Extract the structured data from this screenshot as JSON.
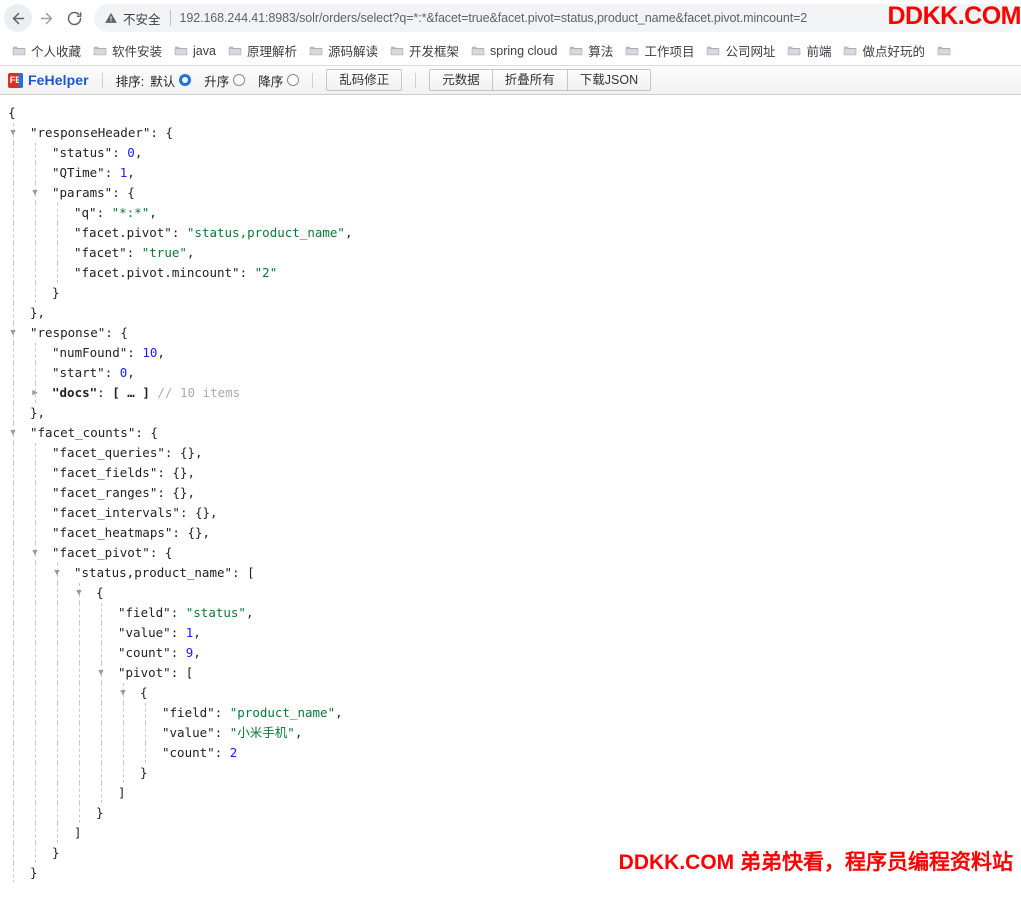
{
  "browser": {
    "back_icon": "arrow-left-icon",
    "forward_icon": "arrow-right-icon",
    "reload_icon": "reload-icon",
    "security_icon": "warning-triangle-icon",
    "security_label": "不安全",
    "url": "192.168.244.41:8983/solr/orders/select?q=*:*&facet=true&facet.pivot=status,product_name&facet.pivot.mincount=2"
  },
  "bookmarks": [
    {
      "label": "个人收藏",
      "icon": "folder-icon"
    },
    {
      "label": "软件安装",
      "icon": "folder-icon"
    },
    {
      "label": "java",
      "icon": "folder-icon"
    },
    {
      "label": "原理解析",
      "icon": "folder-icon"
    },
    {
      "label": "源码解读",
      "icon": "folder-icon"
    },
    {
      "label": "开发框架",
      "icon": "folder-icon"
    },
    {
      "label": "spring cloud",
      "icon": "folder-icon"
    },
    {
      "label": "算法",
      "icon": "folder-icon"
    },
    {
      "label": "工作项目",
      "icon": "folder-icon"
    },
    {
      "label": "公司网址",
      "icon": "folder-icon"
    },
    {
      "label": "前端",
      "icon": "folder-icon"
    },
    {
      "label": "做点好玩的",
      "icon": "folder-icon"
    },
    {
      "label": "",
      "icon": "folder-icon"
    }
  ],
  "fehelper": {
    "logo_text": "FE",
    "title": "FeHelper",
    "sort_label": "排序:",
    "sort_options": [
      {
        "label": "默认",
        "checked": true
      },
      {
        "label": "升序",
        "checked": false
      },
      {
        "label": "降序",
        "checked": false
      }
    ],
    "fix_encoding_button": "乱码修正",
    "buttons": [
      "元数据",
      "折叠所有",
      "下载JSON"
    ]
  },
  "json_lines": [
    {
      "indent": 0,
      "tri": "",
      "html": "{"
    },
    {
      "indent": 1,
      "tri": "down",
      "html": "<span class=\"k\">\"responseHeader\"</span><span class=\"pun\">: {</span>"
    },
    {
      "indent": 2,
      "tri": "",
      "html": "<span class=\"k\">\"status\"</span><span class=\"pun\">: </span><span class=\"num\">0</span><span class=\"pun\">,</span>"
    },
    {
      "indent": 2,
      "tri": "",
      "html": "<span class=\"k\">\"QTime\"</span><span class=\"pun\">: </span><span class=\"num\">1</span><span class=\"pun\">,</span>"
    },
    {
      "indent": 2,
      "tri": "down",
      "html": "<span class=\"k\">\"params\"</span><span class=\"pun\">: {</span>"
    },
    {
      "indent": 3,
      "tri": "",
      "html": "<span class=\"k\">\"q\"</span><span class=\"pun\">: </span><span class=\"str\">\"*:*\"</span><span class=\"pun\">,</span>"
    },
    {
      "indent": 3,
      "tri": "",
      "html": "<span class=\"k\">\"facet.pivot\"</span><span class=\"pun\">: </span><span class=\"str\">\"status,product_name\"</span><span class=\"pun\">,</span>"
    },
    {
      "indent": 3,
      "tri": "",
      "html": "<span class=\"k\">\"facet\"</span><span class=\"pun\">: </span><span class=\"str\">\"true\"</span><span class=\"pun\">,</span>"
    },
    {
      "indent": 3,
      "tri": "",
      "html": "<span class=\"k\">\"facet.pivot.mincount\"</span><span class=\"pun\">: </span><span class=\"str\">\"2\"</span>"
    },
    {
      "indent": 2,
      "tri": "",
      "html": "<span class=\"pun\">}</span>"
    },
    {
      "indent": 1,
      "tri": "",
      "html": "<span class=\"pun\">},</span>"
    },
    {
      "indent": 1,
      "tri": "down",
      "html": "<span class=\"k\">\"response\"</span><span class=\"pun\">: {</span>"
    },
    {
      "indent": 2,
      "tri": "",
      "html": "<span class=\"k\">\"numFound\"</span><span class=\"pun\">: </span><span class=\"num\">10</span><span class=\"pun\">,</span>"
    },
    {
      "indent": 2,
      "tri": "",
      "html": "<span class=\"k\">\"start\"</span><span class=\"pun\">: </span><span class=\"num\">0</span><span class=\"pun\">,</span>"
    },
    {
      "indent": 2,
      "tri": "right",
      "html": "<span class=\"kb\">\"docs\"</span><span class=\"pun\">: </span><span class=\"kb\">[ … ]</span><span class=\"cmt\"> // 10 items</span>"
    },
    {
      "indent": 1,
      "tri": "",
      "html": "<span class=\"pun\">},</span>"
    },
    {
      "indent": 1,
      "tri": "down",
      "html": "<span class=\"k\">\"facet_counts\"</span><span class=\"pun\">: {</span>"
    },
    {
      "indent": 2,
      "tri": "",
      "html": "<span class=\"k\">\"facet_queries\"</span><span class=\"pun\">: {},</span>"
    },
    {
      "indent": 2,
      "tri": "",
      "html": "<span class=\"k\">\"facet_fields\"</span><span class=\"pun\">: {},</span>"
    },
    {
      "indent": 2,
      "tri": "",
      "html": "<span class=\"k\">\"facet_ranges\"</span><span class=\"pun\">: {},</span>"
    },
    {
      "indent": 2,
      "tri": "",
      "html": "<span class=\"k\">\"facet_intervals\"</span><span class=\"pun\">: {},</span>"
    },
    {
      "indent": 2,
      "tri": "",
      "html": "<span class=\"k\">\"facet_heatmaps\"</span><span class=\"pun\">: {},</span>"
    },
    {
      "indent": 2,
      "tri": "down",
      "html": "<span class=\"k\">\"facet_pivot\"</span><span class=\"pun\">: {</span>"
    },
    {
      "indent": 3,
      "tri": "down",
      "html": "<span class=\"k\">\"status,product_name\"</span><span class=\"pun\">: [</span>"
    },
    {
      "indent": 4,
      "tri": "down",
      "html": "<span class=\"pun\">{</span>"
    },
    {
      "indent": 5,
      "tri": "",
      "html": "<span class=\"k\">\"field\"</span><span class=\"pun\">: </span><span class=\"str\">\"status\"</span><span class=\"pun\">,</span>"
    },
    {
      "indent": 5,
      "tri": "",
      "html": "<span class=\"k\">\"value\"</span><span class=\"pun\">: </span><span class=\"num\">1</span><span class=\"pun\">,</span>"
    },
    {
      "indent": 5,
      "tri": "",
      "html": "<span class=\"k\">\"count\"</span><span class=\"pun\">: </span><span class=\"num\">9</span><span class=\"pun\">,</span>"
    },
    {
      "indent": 5,
      "tri": "down",
      "html": "<span class=\"k\">\"pivot\"</span><span class=\"pun\">: [</span>"
    },
    {
      "indent": 6,
      "tri": "down",
      "html": "<span class=\"pun\">{</span>"
    },
    {
      "indent": 7,
      "tri": "",
      "html": "<span class=\"k\">\"field\"</span><span class=\"pun\">: </span><span class=\"str\">\"product_name\"</span><span class=\"pun\">,</span>"
    },
    {
      "indent": 7,
      "tri": "",
      "html": "<span class=\"k\">\"value\"</span><span class=\"pun\">: </span><span class=\"str\">\"小米手机\"</span><span class=\"pun\">,</span>"
    },
    {
      "indent": 7,
      "tri": "",
      "html": "<span class=\"k\">\"count\"</span><span class=\"pun\">: </span><span class=\"num\">2</span>"
    },
    {
      "indent": 6,
      "tri": "",
      "html": "<span class=\"pun\">}</span>"
    },
    {
      "indent": 5,
      "tri": "",
      "html": "<span class=\"pun\">]</span>"
    },
    {
      "indent": 4,
      "tri": "",
      "html": "<span class=\"pun\">}</span>"
    },
    {
      "indent": 3,
      "tri": "",
      "html": "<span class=\"pun\">]</span>"
    },
    {
      "indent": 2,
      "tri": "",
      "html": "<span class=\"pun\">}</span>"
    },
    {
      "indent": 1,
      "tri": "",
      "html": "<span class=\"pun\">}</span>"
    },
    {
      "indent": 0,
      "tri": "",
      "html": "<span class=\"pun\">}</span>"
    }
  ],
  "watermarks": {
    "top": "DDKK.COM",
    "bottom": "DDKK.COM 弟弟快看，程序员编程资料站",
    "color": "#ff0000"
  }
}
